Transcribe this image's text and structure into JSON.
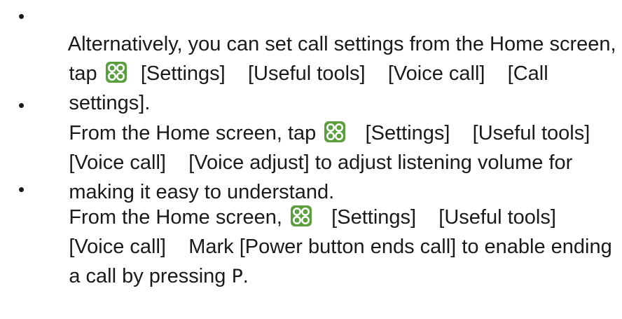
{
  "items": [
    {
      "lines": [
        [
          "Alternatively, you can set call settings from the Home screen,"
        ],
        [
          "tap ",
          "icon",
          "  [Settings]    [Useful tools]    [Voice call]    [Call"
        ],
        [
          "settings]."
        ]
      ]
    },
    {
      "lines": [
        [
          "From the Home screen, tap ",
          "icon",
          "   [Settings]    [Useful tools]"
        ],
        [
          "[Voice call]    [Voice adjust] to adjust listening volume for"
        ],
        [
          "making it easy to understand."
        ]
      ]
    },
    {
      "lines": [
        [
          "From the Home screen, ",
          "icon",
          "   [Settings]    [Useful tools]"
        ],
        [
          "[Voice call]    Mark [Power button ends call] to enable ending"
        ],
        [
          "a call by pressing ",
          "P",
          "."
        ]
      ]
    }
  ],
  "bullet_char": "•",
  "icons": {
    "settings": "settings-app-icon"
  },
  "colors": {
    "text": "#1a1a1a",
    "icon_bg": "#5b9e3e"
  }
}
